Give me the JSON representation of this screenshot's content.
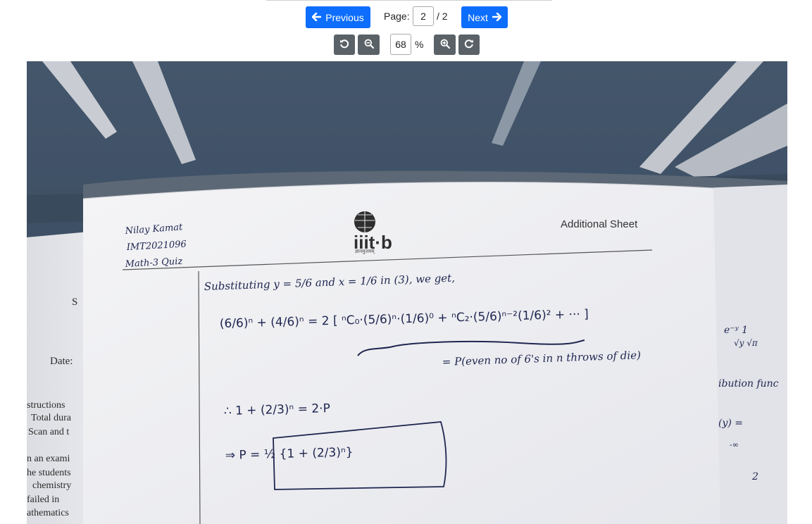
{
  "toolbar": {
    "previous_label": "Previous",
    "next_label": "Next",
    "page_label": "Page:",
    "page_value": "2",
    "page_total": "/ 2",
    "zoom_value": "68",
    "zoom_unit": "%"
  },
  "document": {
    "header_right": "Additional Sheet",
    "logo_text": "iiit·b",
    "logo_motto": "ज्ञानमुत्तमम्",
    "name": "Nilay Kamat",
    "roll": "IMT2021096",
    "course": "Math-3 Quiz",
    "line1": "Substituting y = 5/6 and x = 1/6 in (3), we get,",
    "line2": "(6/6)ⁿ + (4/6)ⁿ = 2 [ ⁿC₀·(5/6)ⁿ·(1/6)⁰ + ⁿC₂·(5/6)ⁿ⁻²(1/6)² + ··· ]",
    "line3": "= P(even no of 6's in n throws of die)",
    "line4": "∴  1 + (2/3)ⁿ = 2·P",
    "line5": "⇒  P = ½ {1 + (2/3)ⁿ}",
    "left_partial": [
      "S",
      "Date:",
      "structions",
      "Total dura",
      "Scan and t",
      "n an exami",
      "he students",
      "chemistry",
      "failed in",
      "athematics"
    ],
    "right_partial": [
      "e⁻ʸ  1",
      "√y   √π",
      "ibution func",
      "(y) =",
      "-∞",
      "2"
    ]
  }
}
